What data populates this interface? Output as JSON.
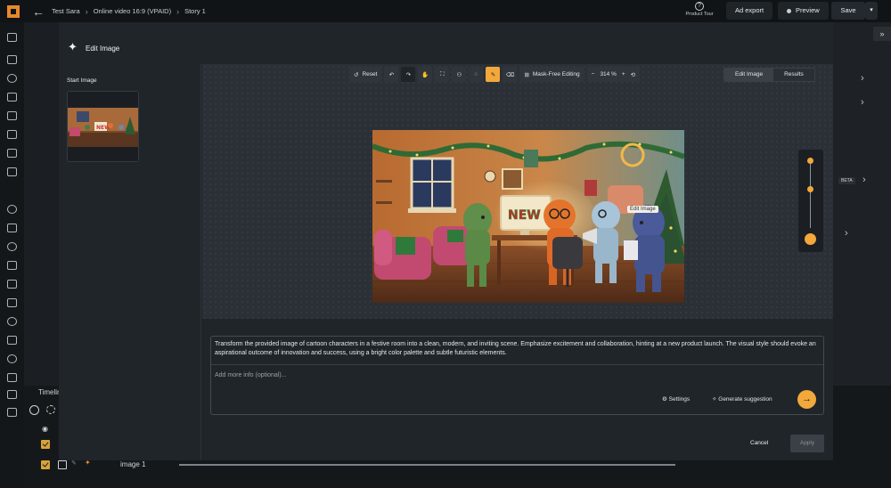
{
  "topbar": {
    "breadcrumbs": [
      "Test Sara",
      "Online video 16:9 (VPAID)",
      "Story 1"
    ],
    "product_tour": "Product Tour",
    "ad_export": "Ad export",
    "preview": "Preview",
    "save": "Save"
  },
  "modal": {
    "title": "Edit Image",
    "start_image_label": "Start Image",
    "toolbar": {
      "reset": "Reset",
      "mask_free": "Mask-Free Editing",
      "zoom_minus": "−",
      "zoom": "314 %",
      "zoom_plus": "+"
    },
    "tabs": [
      "Edit Image",
      "Results"
    ],
    "image_tooltip": "Edit Image",
    "image_sign_text": "NEW",
    "prompt": "Transform the provided image of cartoon characters in a festive room into a clean, modern, and inviting scene. Emphasize excitement and collaboration, hinting at a new product launch. The visual style should evoke an aspirational outcome of innovation and success, using a bright color palette and subtle futuristic elements.",
    "more_info_placeholder": "Add more info (optional)...",
    "settings": "Settings",
    "generate_suggestion": "Generate suggestion",
    "cancel": "Cancel",
    "apply": "Apply"
  },
  "background": {
    "timeline_tab": "Timeline",
    "timeline_item": "image 1",
    "beta_badge": "BETA"
  },
  "colors": {
    "accent": "#f2a83a",
    "modal_bg": "#20252a",
    "canvas_bg": "#2a3036"
  }
}
